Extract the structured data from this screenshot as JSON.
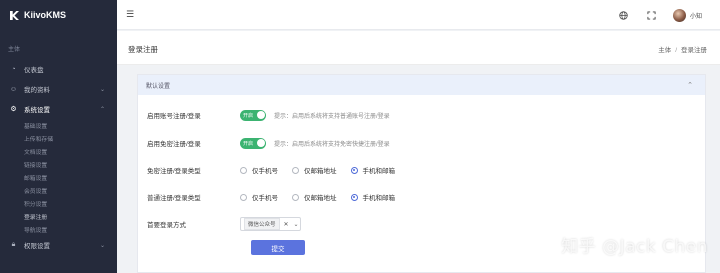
{
  "app": {
    "name": "KiivoKMS"
  },
  "sidebar": {
    "section": "主体",
    "items": [
      {
        "label": "仪表盘",
        "icon": "dashboard-icon"
      },
      {
        "label": "我的资料",
        "icon": "user-icon"
      },
      {
        "label": "系统设置",
        "icon": "gear-icon"
      }
    ],
    "sub_items": [
      "基础设置",
      "上传和存储",
      "文档设置",
      "链接设置",
      "邮箱设置",
      "会员设置",
      "积分设置",
      "登录注册",
      "导航设置"
    ],
    "bottom_item": {
      "label": "权限设置",
      "icon": "lock-icon"
    }
  },
  "header": {
    "user_name": "小知"
  },
  "page": {
    "title": "登录注册",
    "breadcrumb": [
      "主体",
      "登录注册"
    ]
  },
  "card": {
    "title": "默认设置",
    "fields": {
      "account_login": {
        "label": "启用账号注册/登录",
        "switch_text": "开启",
        "hint": "提示：启用后系统将支持普通账号注册/登录"
      },
      "nopass_login": {
        "label": "启用免密注册/登录",
        "switch_text": "开启",
        "hint": "提示：启用后系统将支持免密快捷注册/登录"
      },
      "nopass_type": {
        "label": "免密注册/登录类型",
        "options": [
          "仅手机号",
          "仅邮箱地址",
          "手机和邮箱"
        ],
        "selected": 2
      },
      "normal_type": {
        "label": "普通注册/登录类型",
        "options": [
          "仅手机号",
          "仅邮箱地址",
          "手机和邮箱"
        ],
        "selected": 2
      },
      "preferred": {
        "label": "首要登录方式",
        "value": "微信公众号"
      }
    },
    "submit_label": "提交"
  },
  "watermark": "知乎 @Jack Chen"
}
